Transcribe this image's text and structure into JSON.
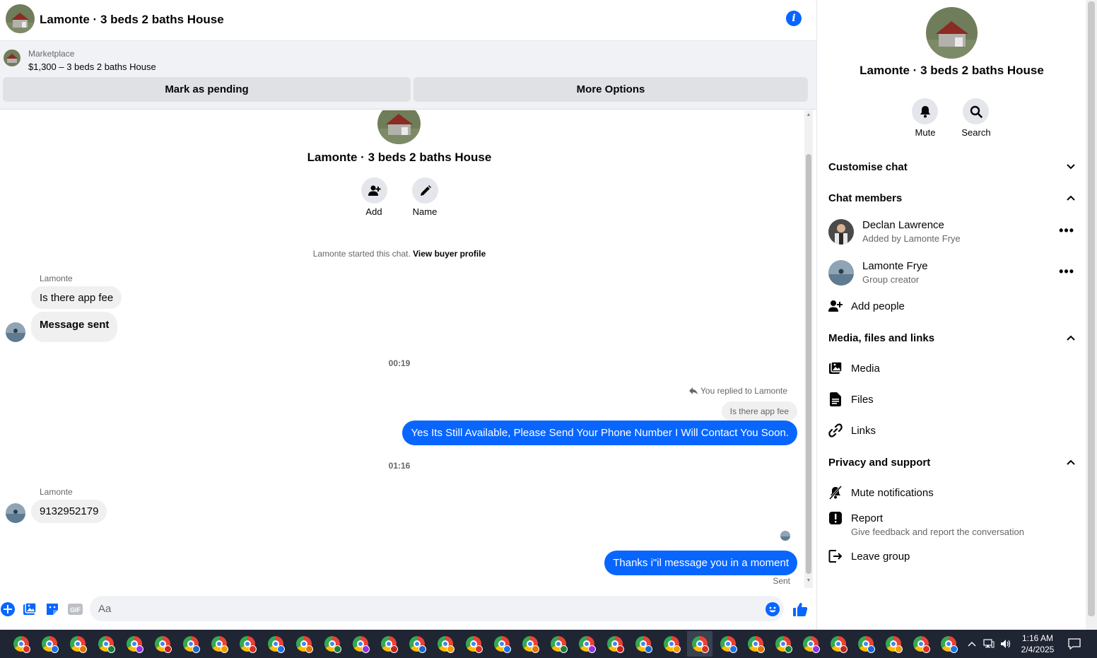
{
  "header": {
    "title": "Lamonte · 3 beds 2 baths House"
  },
  "marketplace": {
    "label": "Marketplace",
    "listing": "$1,300 – 3 beds 2 baths House",
    "mark_pending": "Mark as pending",
    "more_options": "More Options"
  },
  "conversation": {
    "title": "Lamonte · 3 beds 2 baths House",
    "add_label": "Add",
    "name_label": "Name",
    "started_text": "Lamonte started this chat.",
    "view_profile": "View buyer profile",
    "messages": [
      {
        "sender": "Lamonte",
        "text": "Is there app fee"
      },
      {
        "text": "Message sent"
      }
    ],
    "time1": "00:19",
    "reply_note": "You replied to Lamonte",
    "reply_quote": "Is there app fee",
    "out1": "Yes Its Still Available, Please Send Your Phone Number I Will Contact You Soon.",
    "time2": "01:16",
    "in2_sender": "Lamonte",
    "in2_text": "9132952179",
    "out2": "Thanks i\"il message you in a moment",
    "status": "Sent"
  },
  "composer": {
    "placeholder": "Aa"
  },
  "panel": {
    "title": "Lamonte · 3 beds 2 baths House",
    "mute": "Mute",
    "search": "Search",
    "customise": "Customise chat",
    "chat_members": "Chat members",
    "members": [
      {
        "name": "Declan Lawrence",
        "sub": "Added by Lamonte Frye"
      },
      {
        "name": "Lamonte Frye",
        "sub": "Group creator"
      }
    ],
    "add_people": "Add people",
    "media_section": "Media, files and links",
    "media": "Media",
    "files": "Files",
    "links": "Links",
    "privacy_section": "Privacy and support",
    "mute_notifications": "Mute notifications",
    "report": "Report",
    "report_sub": "Give feedback and report the conversation",
    "leave_group": "Leave group"
  },
  "taskbar": {
    "time": "1:16 AM",
    "date": "2/4/2025"
  },
  "colors": {
    "accent": "#0866ff",
    "bubble_in": "#f0f0f0",
    "taskbar": "#1f2533"
  }
}
